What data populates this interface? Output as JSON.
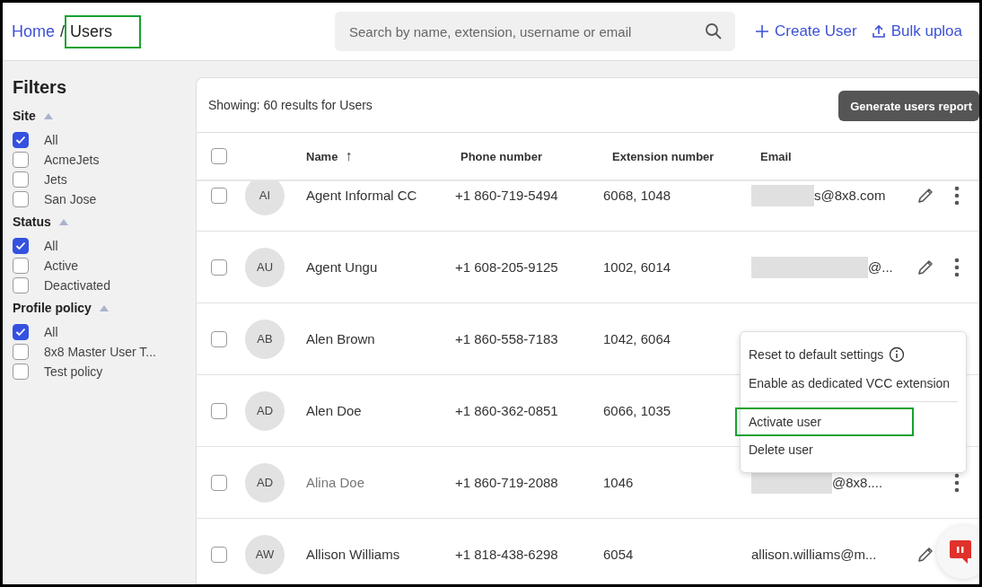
{
  "breadcrumb": [
    {
      "label": "Home",
      "current": false,
      "highlighted": false
    },
    {
      "label": "Users",
      "current": true,
      "highlighted": true
    }
  ],
  "breadcrumb_separator": "/",
  "search": {
    "placeholder": "Search by name, extension, username or email"
  },
  "header_actions": [
    {
      "kind": "create",
      "label": "Create User"
    },
    {
      "kind": "upload",
      "label": "Bulk uploa"
    }
  ],
  "filters": {
    "title": "Filters",
    "groups": [
      {
        "title": "Site",
        "expanded": true,
        "options": [
          {
            "label": "All",
            "checked": true
          },
          {
            "label": "AcmeJets",
            "checked": false
          },
          {
            "label": "Jets",
            "checked": false
          },
          {
            "label": "San Jose",
            "checked": false
          }
        ]
      },
      {
        "title": "Status",
        "expanded": true,
        "options": [
          {
            "label": "All",
            "checked": true
          },
          {
            "label": "Active",
            "checked": false
          },
          {
            "label": "Deactivated",
            "checked": false
          }
        ]
      },
      {
        "title": "Profile policy",
        "expanded": true,
        "options": [
          {
            "label": "All",
            "checked": true
          },
          {
            "label": "8x8 Master User T...",
            "checked": false
          },
          {
            "label": "Test policy",
            "checked": false
          }
        ]
      }
    ]
  },
  "results_summary": "Showing: 60 results for Users",
  "report_button": "Generate users report",
  "table": {
    "select_all_checked": false,
    "columns": [
      {
        "label": "Name",
        "sort_indicator": "↑"
      },
      {
        "label": "Phone number"
      },
      {
        "label": "Extension number"
      },
      {
        "label": "Email"
      }
    ],
    "rows": [
      {
        "initials": "AI",
        "name": "Agent Informal CC",
        "phone": "+1 860-719-5494",
        "extension": "6068, 1048",
        "email": "s@8x8.com",
        "email_redacted": true,
        "checked": false,
        "deactivated": false,
        "edit_icon": true,
        "more_icon": true
      },
      {
        "initials": "AU",
        "name": "Agent Ungu",
        "phone": "+1 608-205-9125",
        "extension": "1002, 6014",
        "email": "@...",
        "email_redacted": true,
        "checked": false,
        "deactivated": false,
        "edit_icon": true,
        "more_icon": true
      },
      {
        "initials": "AB",
        "name": "Alen Brown",
        "phone": "+1 860-558-7183",
        "extension": "1042, 6064",
        "checked": false,
        "deactivated": false,
        "edit_icon": false,
        "more_icon": false
      },
      {
        "initials": "AD",
        "name": "Alen Doe",
        "phone": "+1 860-362-0851",
        "extension": "6066, 1035",
        "checked": false,
        "deactivated": false,
        "edit_icon": false,
        "more_icon": false
      },
      {
        "initials": "AD",
        "name": "Alina Doe",
        "phone": "+1 860-719-2088",
        "extension": "1046",
        "email": "@8x8....",
        "email_redacted": true,
        "checked": false,
        "deactivated": true,
        "edit_icon": false,
        "more_icon": true
      },
      {
        "initials": "AW",
        "name": "Allison Williams",
        "phone": "+1 818-438-6298",
        "extension": "6054",
        "email": "allison.williams@m...",
        "email_redacted": false,
        "checked": false,
        "deactivated": false,
        "edit_icon": true,
        "more_icon": false
      }
    ]
  },
  "context_menu": {
    "items": [
      {
        "label": "Reset to default settings",
        "info_icon": true,
        "divider_after": false,
        "highlighted": false
      },
      {
        "label": "Enable as dedicated VCC extension",
        "info_icon": false,
        "divider_after": true,
        "highlighted": false
      },
      {
        "label": "Activate user",
        "info_icon": false,
        "divider_after": false,
        "highlighted": true
      },
      {
        "label": "Delete user",
        "info_icon": false,
        "divider_after": false,
        "highlighted": false
      }
    ]
  },
  "chat_button": true
}
